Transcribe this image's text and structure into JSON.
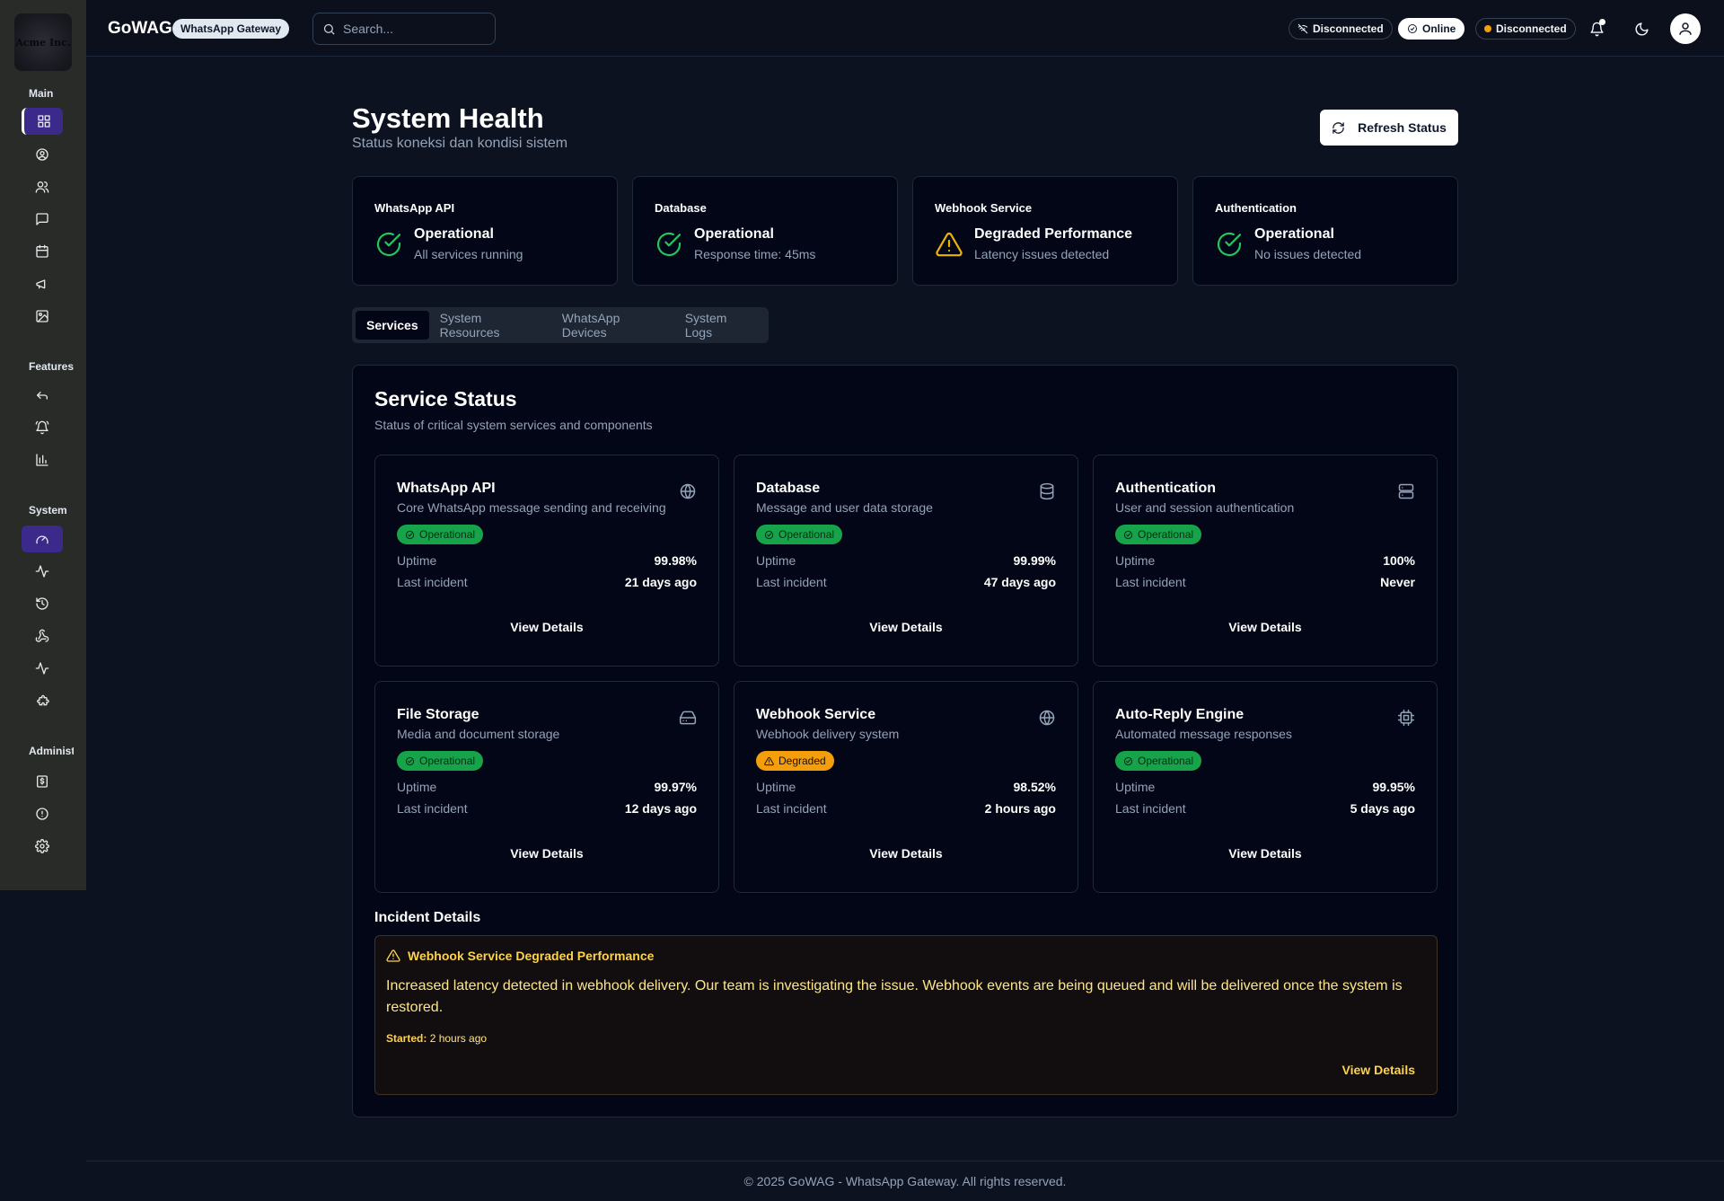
{
  "sidebar": {
    "logo_text": "Acme Inc.",
    "sections": [
      "Main",
      "Features",
      "System",
      "Administ"
    ],
    "main_icons": [
      "dashboard-icon",
      "user-circle-icon",
      "users-icon",
      "message-icon",
      "calendar-icon",
      "megaphone-icon",
      "image-icon"
    ],
    "feature_icons": [
      "reply-icon",
      "bell-ring-icon",
      "bar-chart-icon"
    ],
    "system_icons": [
      "gauge-icon",
      "activity-icon",
      "history-icon",
      "webhook-icon",
      "pulse-icon",
      "puzzle-icon"
    ],
    "admin_icons": [
      "billing-icon",
      "info-icon",
      "settings-icon"
    ]
  },
  "header": {
    "brand": "GoWAG",
    "badge": "WhatsApp Gateway",
    "search_placeholder": "Search...",
    "status1": "Disconnected",
    "status2": "Online",
    "status3": "Disconnected"
  },
  "page": {
    "title": "System Health",
    "subtitle": "Status koneksi dan kondisi sistem",
    "refresh": "Refresh Status"
  },
  "summary": [
    {
      "title": "WhatsApp API",
      "status": "Operational",
      "detail": "All services running",
      "icon": "check-circle-icon",
      "color": "#22c55e"
    },
    {
      "title": "Database",
      "status": "Operational",
      "detail": "Response time: 45ms",
      "icon": "check-circle-icon",
      "color": "#22c55e"
    },
    {
      "title": "Webhook Service",
      "status": "Degraded Performance",
      "detail": "Latency issues detected",
      "icon": "warning-icon",
      "color": "#eab308"
    },
    {
      "title": "Authentication",
      "status": "Operational",
      "detail": "No issues detected",
      "icon": "check-circle-icon",
      "color": "#22c55e"
    }
  ],
  "tabs": [
    "Services",
    "System Resources",
    "WhatsApp Devices",
    "System Logs"
  ],
  "panel": {
    "title": "Service Status",
    "subtitle": "Status of critical system services and components",
    "uptime_label": "Uptime",
    "incident_label": "Last incident",
    "link": "View Details"
  },
  "services": [
    {
      "name": "WhatsApp API",
      "desc": "Core WhatsApp message sending and receiving",
      "badge": "Operational",
      "uptime": "99.98%",
      "incident": "21 days ago",
      "icon": "globe-icon"
    },
    {
      "name": "Database",
      "desc": "Message and user data storage",
      "badge": "Operational",
      "uptime": "99.99%",
      "incident": "47 days ago",
      "icon": "database-icon"
    },
    {
      "name": "Authentication",
      "desc": "User and session authentication",
      "badge": "Operational",
      "uptime": "100%",
      "incident": "Never",
      "icon": "server-icon"
    },
    {
      "name": "File Storage",
      "desc": "Media and document storage",
      "badge": "Operational",
      "uptime": "99.97%",
      "incident": "12 days ago",
      "icon": "hard-drive-icon"
    },
    {
      "name": "Webhook Service",
      "desc": "Webhook delivery system",
      "badge": "Degraded",
      "uptime": "98.52%",
      "incident": "2 hours ago",
      "icon": "globe-icon"
    },
    {
      "name": "Auto-Reply Engine",
      "desc": "Automated message responses",
      "badge": "Operational",
      "uptime": "99.95%",
      "incident": "5 days ago",
      "icon": "cpu-icon"
    }
  ],
  "incident": {
    "section_title": "Incident Details",
    "title": "Webhook Service Degraded Performance",
    "body": "Increased latency detected in webhook delivery. Our team is investigating the issue. Webhook events are being queued and will be delivered once the system is restored.",
    "started_label": "Started:",
    "started_value": "2 hours ago",
    "link": "View Details"
  },
  "footer": "© 2025 GoWAG - WhatsApp Gateway. All rights reserved."
}
